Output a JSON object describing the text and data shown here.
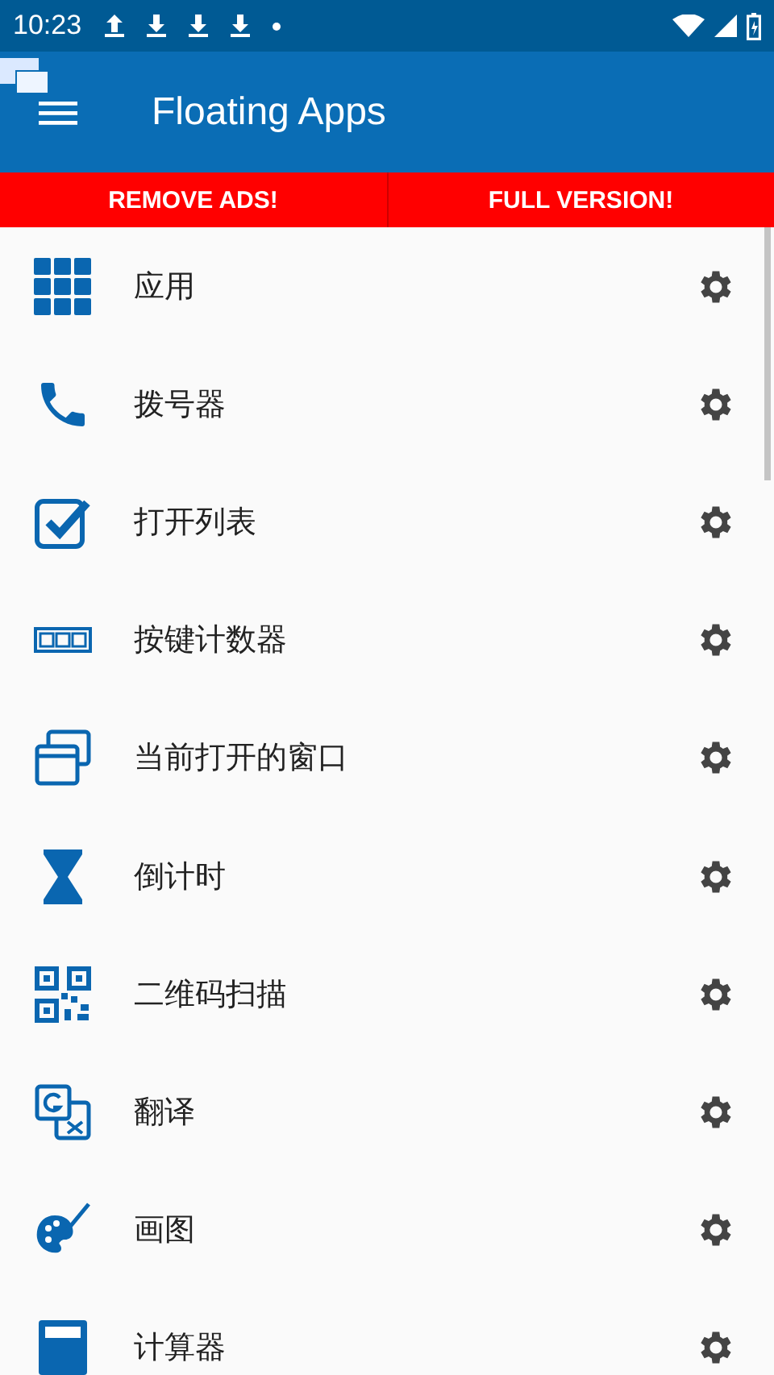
{
  "status_bar": {
    "time": "10:23"
  },
  "app_bar": {
    "title": "Floating Apps"
  },
  "promo_buttons": [
    "REMOVE ADS!",
    "FULL VERSION!"
  ],
  "items": [
    {
      "label": "应用"
    },
    {
      "label": "拨号器"
    },
    {
      "label": "打开列表"
    },
    {
      "label": "按键计数器"
    },
    {
      "label": "当前打开的窗口"
    },
    {
      "label": "倒计时"
    },
    {
      "label": "二维码扫描"
    },
    {
      "label": "翻译"
    },
    {
      "label": "画图"
    },
    {
      "label": "计算器"
    }
  ]
}
